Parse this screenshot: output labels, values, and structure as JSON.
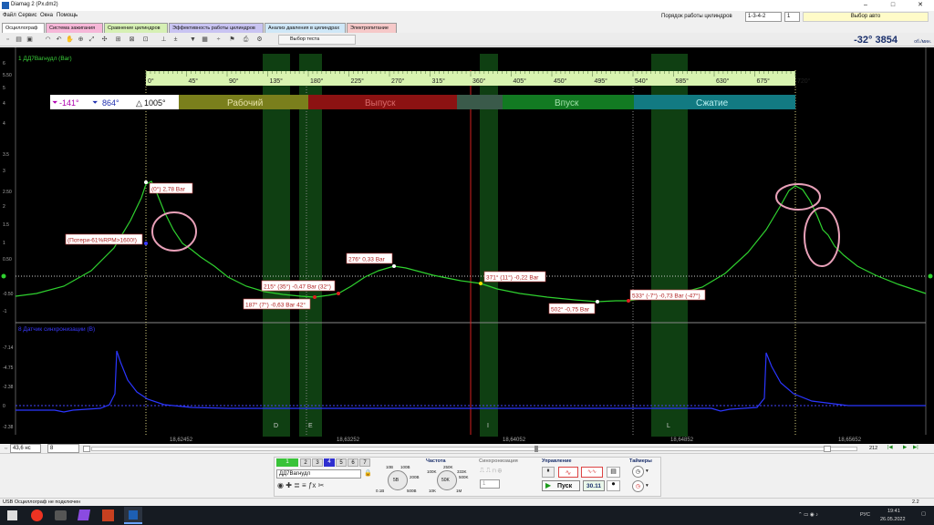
{
  "window": {
    "title": "Diamag 2 (Px.dm2)",
    "controls": [
      "–",
      "□",
      "✕"
    ]
  },
  "menu": [
    "Файл",
    "Сервис",
    "Окна",
    "Помощь"
  ],
  "cylinder_order": {
    "label": "Порядок работы цилиндров",
    "value": "1-3-4-2",
    "cyl": "1"
  },
  "auto_select": "Выбор авто",
  "tabs": [
    {
      "label": "Осциллограф",
      "color": "#ffffff"
    },
    {
      "label": "Система зажигания",
      "color": "#f6b7d8"
    },
    {
      "label": "Сравнение цилиндров",
      "color": "#d6f0b4"
    },
    {
      "label": "Эффективность работы цилиндров",
      "color": "#c9c4f2"
    },
    {
      "label": "Анализ давления в цилиндрах",
      "color": "#cfe7f7"
    },
    {
      "label": "Электропитание",
      "color": "#f6c9c9"
    }
  ],
  "toolbar": {
    "test_select": "Выбор теста"
  },
  "readout": {
    "angle": "-32°",
    "rpm": "3854",
    "unit": "об./мин."
  },
  "scope": {
    "channel1": "1 ДД7Вагнудл (Bar)",
    "channel2": "8 Датчик синхронизации (В)",
    "y1_ticks": [
      "6",
      "5.50",
      "5",
      "4.5",
      "4",
      "3.5",
      "3",
      "2.50",
      "2",
      "1.5",
      "1",
      "0.50",
      "0",
      "-0.50",
      "-1"
    ],
    "y2_ticks": [
      "-7.14",
      "-4.75",
      "-2.38",
      "0",
      "-2.38"
    ],
    "angle_ticks": [
      "0°",
      "45°",
      "90°",
      "135°",
      "180°",
      "225°",
      "270°",
      "315°",
      "360°",
      "405°",
      "450°",
      "495°",
      "540°",
      "585°",
      "630°",
      "675°",
      "720°"
    ],
    "cursors": {
      "a": "-141°",
      "b": "864°",
      "delta": "1005°"
    },
    "phases": [
      {
        "label": "Рабочий",
        "color": "#7a7f1c"
      },
      {
        "label": "Выпуск",
        "color": "#8c1212"
      },
      {
        "label": "Впуск",
        "color": "#127a22"
      },
      {
        "label": "Сжатие",
        "color": "#127a82"
      }
    ],
    "markers": [
      "D",
      "E",
      "I",
      "L"
    ],
    "time_ticks": [
      "18,62452",
      "18,63252",
      "18,64052",
      "18,64852",
      "18,65652"
    ],
    "annotations": [
      "(0°) 2,78 Bar",
      "(Потери-61%RPM>1600!)",
      "276° 0,33 Bar",
      "215° (35°) -0,47 Bar (32°)",
      "187° (7°) -0,63 Bar 42°",
      "371° (11°) -0,22 Bar",
      "502° -0,75 Bar",
      "533° (-7°) -0,73 Bar (-47°)"
    ]
  },
  "status_ctrl": {
    "time_div": "43,6 нс",
    "channel": "8",
    "page": "212"
  },
  "controls": {
    "channel_select": "ДД7Вагнудл",
    "pages": [
      "1",
      "2",
      "3",
      "4",
      "5",
      "6",
      "7"
    ],
    "freq_label": "Частота",
    "sync_label": "Синхронизация",
    "control_label": "Управление",
    "timers_label": "Таймеры",
    "start_label": "Пуск",
    "sync_value": "1",
    "timer_value": "30.11",
    "knob1": "5B",
    "knob1_ticks": [
      "10B",
      "100B",
      "0.1B",
      "200B",
      "500B"
    ],
    "knob2": "50K",
    "knob2_ticks": [
      "100K",
      "250K",
      "333K",
      "500K",
      "1M",
      "10K"
    ]
  },
  "status": {
    "left": "USB Осциллограф не подключен",
    "right": "2.2"
  },
  "taskbar": {
    "lang": "РУС",
    "time": "19:41",
    "date": "26.05.2022"
  }
}
